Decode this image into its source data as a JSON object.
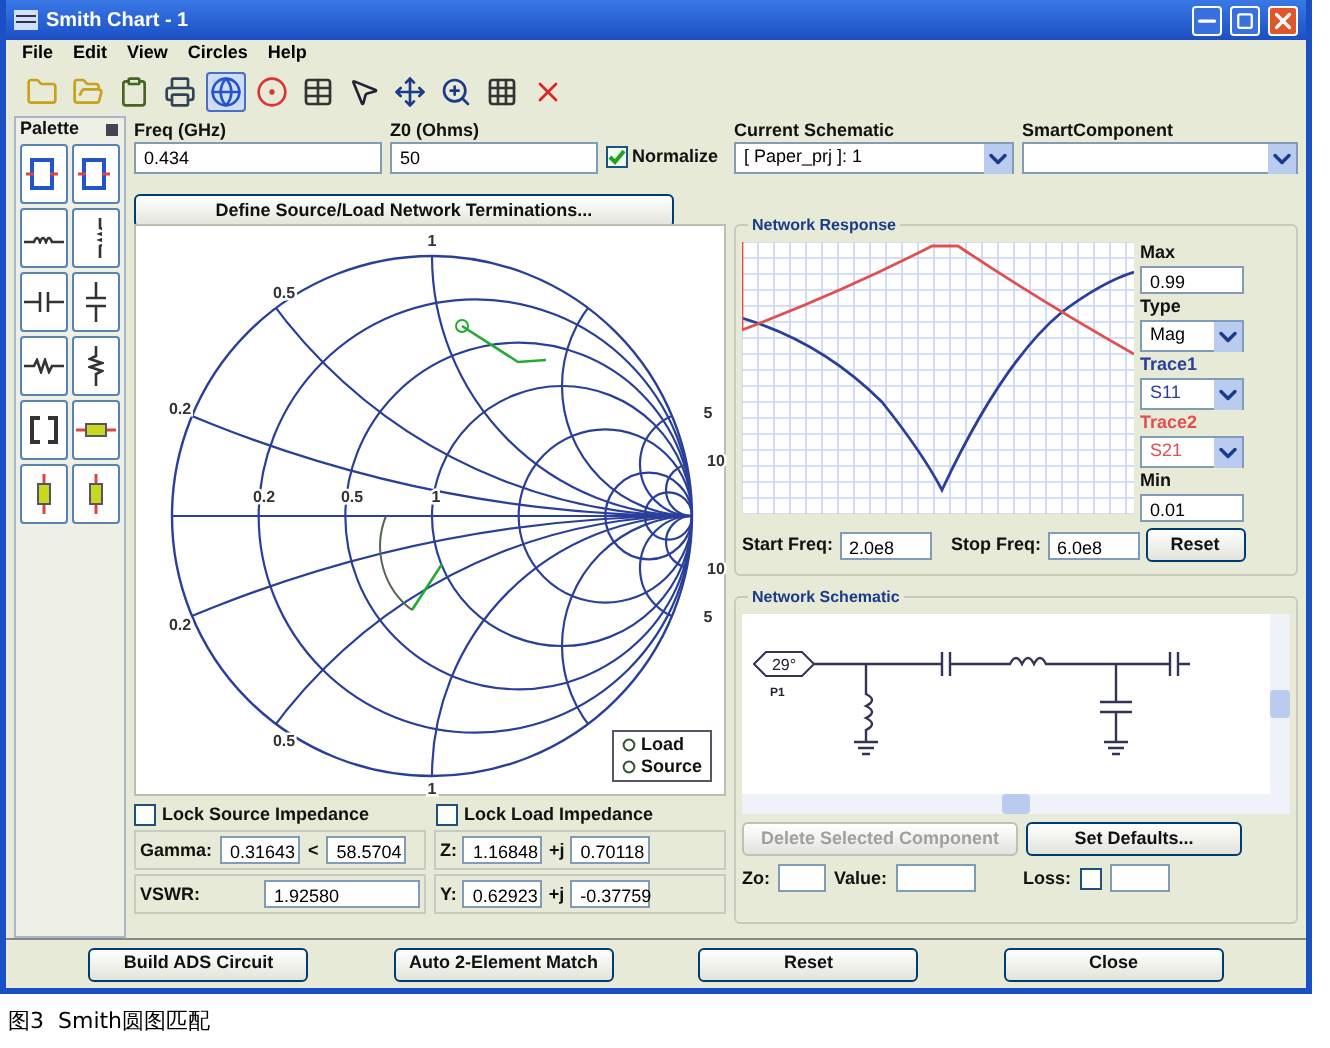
{
  "window": {
    "title": "Smith Chart - 1"
  },
  "menu": [
    "File",
    "Edit",
    "View",
    "Circles",
    "Help"
  ],
  "toolbar": [
    {
      "kind": "new",
      "selected": false
    },
    {
      "kind": "open",
      "selected": false
    },
    {
      "kind": "clipboard",
      "selected": false
    },
    {
      "kind": "print",
      "selected": false
    },
    {
      "kind": "smith",
      "selected": true
    },
    {
      "kind": "polar",
      "selected": false
    },
    {
      "kind": "table",
      "selected": false
    },
    {
      "kind": "pointer",
      "selected": false
    },
    {
      "kind": "move",
      "selected": false
    },
    {
      "kind": "zoom",
      "selected": false
    },
    {
      "kind": "grid",
      "selected": false
    },
    {
      "kind": "delete",
      "selected": false
    }
  ],
  "palette": {
    "title": "Palette"
  },
  "params": {
    "freq": {
      "label": "Freq (GHz)",
      "value": "0.434"
    },
    "z0": {
      "label": "Z0 (Ohms)",
      "value": "50"
    },
    "normalize": {
      "label": "Normalize",
      "checked": true
    }
  },
  "current_schematic": {
    "label": "Current Schematic",
    "value": "[ Paper_prj ]: 1"
  },
  "smart_component": {
    "label": "SmartComponent"
  },
  "define_button": "Define Source/Load Network Terminations...",
  "smith_chart": {
    "labels": [
      "1",
      "0.5",
      "0.2",
      "0.2",
      "0.5",
      "1",
      "0.2",
      "0.5",
      "5",
      "10",
      "10",
      "5",
      "1"
    ],
    "legend": [
      "Load",
      "Source"
    ]
  },
  "network_response": {
    "title": "Network Response",
    "max": {
      "label": "Max",
      "value": "0.99"
    },
    "type": {
      "label": "Type",
      "value": "Mag"
    },
    "traces": [
      {
        "label": "Trace1",
        "value": "S11",
        "color": "#2a3f9a"
      },
      {
        "label": "Trace2",
        "value": "S21",
        "color": "#e05050"
      }
    ],
    "min": {
      "label": "Min",
      "value": "0.01"
    },
    "start": {
      "label": "Start Freq:",
      "value": "2.0e8"
    },
    "stop": {
      "label": "Stop Freq:",
      "value": "6.0e8"
    },
    "reset": "Reset"
  },
  "network_schematic": {
    "title": "Network Schematic",
    "port_label": "29°",
    "port_name": "P1",
    "delete_button": {
      "label": "Delete Selected Component",
      "disabled": true
    },
    "defaults_button": "Set Defaults...",
    "zo_label": "Zo:",
    "value_label": "Value:",
    "loss_label": "Loss:",
    "loss_checked": false
  },
  "impedance": {
    "lock_source": {
      "label": "Lock Source Impedance",
      "checked": false
    },
    "lock_load": {
      "label": "Lock Load Impedance",
      "checked": false
    },
    "gamma": {
      "label": "Gamma:",
      "magnitude": "0.31643",
      "angle_sign": "<",
      "angle": "58.5704"
    },
    "vswr": {
      "label": "VSWR:",
      "value": "1.92580"
    },
    "z": {
      "label": "Z:",
      "real": "1.16848",
      "j": "+j",
      "imag": "0.70118"
    },
    "y": {
      "label": "Y:",
      "real": "0.62923",
      "j": "+j",
      "imag": "-0.37759"
    }
  },
  "buttons": [
    "Build ADS Circuit",
    "Auto 2-Element Match",
    "Reset",
    "Close"
  ],
  "caption": "图3  Smith圆图匹配"
}
